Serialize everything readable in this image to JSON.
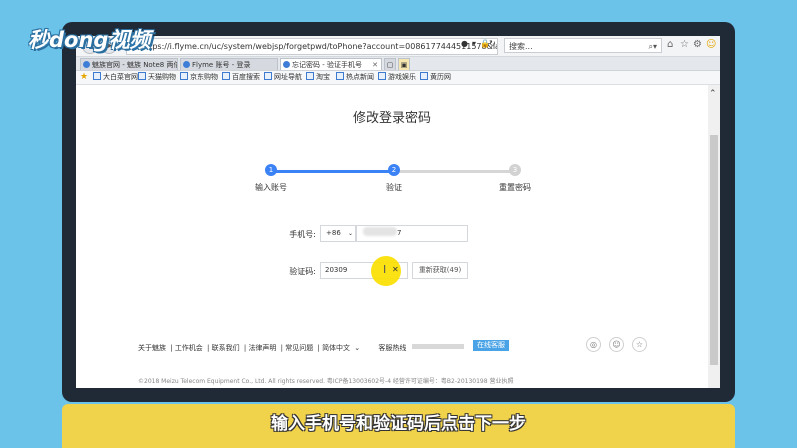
{
  "watermark": "秒dong视频",
  "browser": {
    "url": "https://i.flyme.cn/uc/system/webjsp/forgetpwd/toPhone?account=0086177444511578&lang=zh_CN",
    "search_placeholder": "搜索..."
  },
  "tabs": [
    {
      "label": "魅族官网 - 魅族 Note8 两倍..."
    },
    {
      "label": "Flyme 账号 - 登录"
    },
    {
      "label": "忘记密码 - 验证手机号"
    }
  ],
  "favorites": [
    "大白菜官网",
    "天猫购物",
    "京东购物",
    "百度搜索",
    "网址导航",
    "淘宝",
    "热点新闻",
    "游戏娱乐",
    "黄历网"
  ],
  "page": {
    "title": "修改登录密码",
    "steps": [
      {
        "number": "1",
        "label": "输入账号"
      },
      {
        "number": "2",
        "label": "验证"
      },
      {
        "number": "3",
        "label": "重置密码"
      }
    ],
    "phone_label": "手机号:",
    "country_code": "+86",
    "phone_tail": "7",
    "code_label": "验证码:",
    "code_value": "20309",
    "resend_label": "重新获取(49)"
  },
  "footer": {
    "links": [
      "关于魅族",
      "工作机会",
      "联系我们",
      "法律声明",
      "常见问题",
      "简体中文"
    ],
    "hotline_label": "客服热线",
    "online_service": "在线客服",
    "copyright": "©2018 Meizu Telecom Equipment Co., Ltd. All rights reserved.  粤ICP备13003602号-4  经营许可证编号：粤B2-20130198  营业执照"
  },
  "caption": "输入手机号和验证码后点击下一步",
  "colors": {
    "accent": "#3b82f6",
    "caption_bg": "#f1d24b",
    "background": "#6cc3ea"
  }
}
